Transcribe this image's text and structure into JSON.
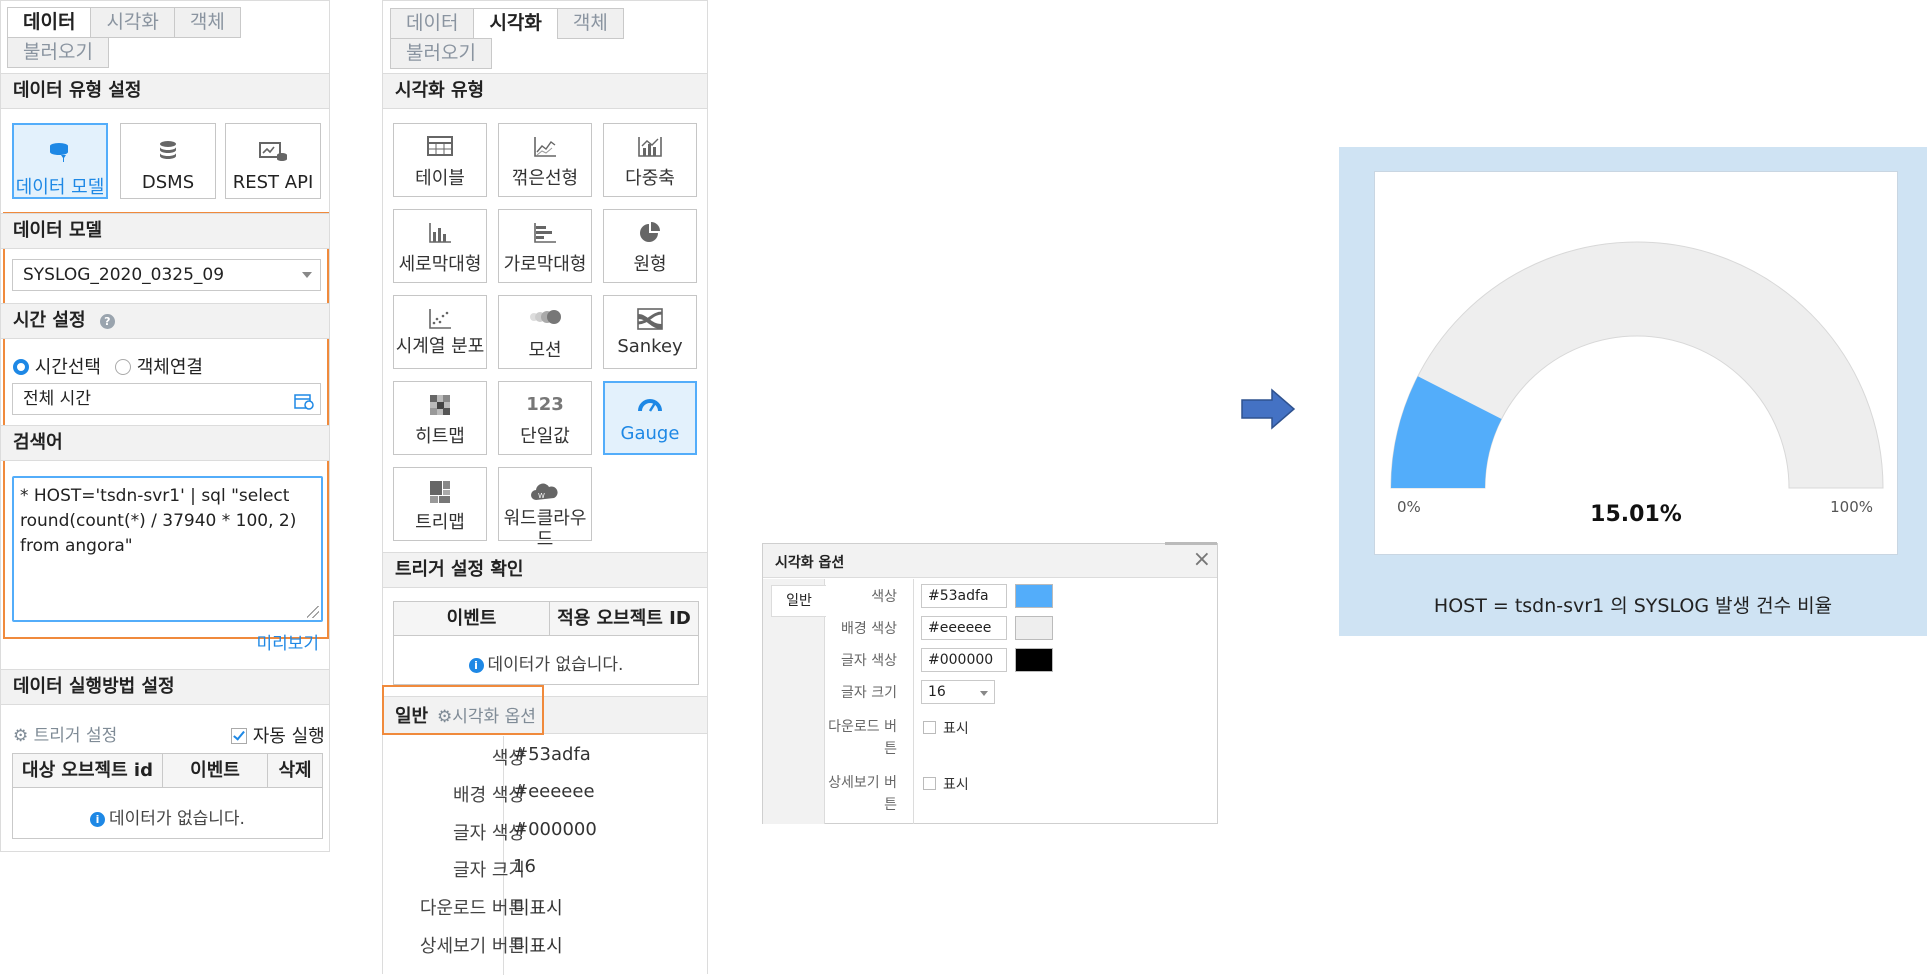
{
  "data_panel": {
    "tabs": [
      "데이터",
      "시각화",
      "객체",
      "불러오기"
    ],
    "data_type_header": "데이터 유형 설정",
    "data_types": [
      {
        "label": "데이터 모델",
        "icon": "data-model-icon",
        "active": true
      },
      {
        "label": "DSMS",
        "icon": "database-icon",
        "active": false
      },
      {
        "label": "REST API",
        "icon": "rest-api-icon",
        "active": false
      }
    ],
    "model_header": "데이터 모델",
    "model_value": "SYSLOG_2020_0325_09",
    "time_header": "시간 설정",
    "time_radio_1": "시간선택",
    "time_radio_2": "객체연결",
    "time_value": "전체 시간",
    "search_header": "검색어",
    "search_query": "*  HOST='tsdn-svr1' |  sql \"select round(count(*) / 37940 * 100, 2) from angora\"",
    "preview_link": "미리보기",
    "exec_header": "데이터 실행방법 설정",
    "trigger_label": "트리거 설정",
    "auto_run_label": "자동 실행",
    "table_headers": [
      "대상 오브젝트 id",
      "이벤트",
      "삭제"
    ],
    "no_data": "데이터가 없습니다."
  },
  "vis_panel": {
    "tabs": [
      "데이터",
      "시각화",
      "객체",
      "불러오기"
    ],
    "vis_type_header": "시각화 유형",
    "vis_types": [
      {
        "label": "테이블",
        "icon": "table-icon"
      },
      {
        "label": "꺾은선형",
        "icon": "line-chart-icon"
      },
      {
        "label": "다중축",
        "icon": "multi-axis-icon"
      },
      {
        "label": "세로막대형",
        "icon": "column-chart-icon"
      },
      {
        "label": "가로막대형",
        "icon": "bar-chart-icon"
      },
      {
        "label": "원형",
        "icon": "pie-chart-icon"
      },
      {
        "label": "시계열 분포",
        "icon": "timeseries-icon"
      },
      {
        "label": "모션",
        "icon": "motion-icon"
      },
      {
        "label": "Sankey",
        "icon": "sankey-icon"
      },
      {
        "label": "히트맵",
        "icon": "heatmap-icon"
      },
      {
        "label": "단일값",
        "icon": "single-value-icon",
        "icon_text": "123"
      },
      {
        "label": "Gauge",
        "icon": "gauge-icon",
        "active": true
      },
      {
        "label": "트리맵",
        "icon": "treemap-icon"
      },
      {
        "label": "워드클라우드",
        "icon": "wordcloud-icon"
      }
    ],
    "trigger_header": "트리거 설정 확인",
    "trigger_table_headers": [
      "이벤트",
      "적용 오브젝트 ID"
    ],
    "no_data": "데이터가 없습니다.",
    "subtab_general": "일반",
    "subtab_options": "시각화 옵션",
    "props": [
      {
        "key": "색상",
        "value": "#53adfa"
      },
      {
        "key": "배경 색상",
        "value": "#eeeeee"
      },
      {
        "key": "글자 색상",
        "value": "#000000"
      },
      {
        "key": "글자 크기",
        "value": "16"
      },
      {
        "key": "다운로드 버튼",
        "value": "미표시"
      },
      {
        "key": "상세보기 버튼",
        "value": "미표시"
      }
    ]
  },
  "options_dialog": {
    "title": "시각화 옵션",
    "close": "×",
    "tab": "일반",
    "color_label": "색상",
    "color_value": "#53adfa",
    "bg_label": "배경 색상",
    "bg_value": "#eeeeee",
    "font_color_label": "글자 색상",
    "font_color_value": "#000000",
    "font_size_label": "글자 크기",
    "font_size_value": "16",
    "download_label_1": "다운로드 버",
    "download_label_2": "튼",
    "detail_label_1": "상세보기 버",
    "detail_label_2": "튼",
    "show_label": "표시"
  },
  "gauge": {
    "value": 15.01,
    "min": 0,
    "max": 100,
    "value_label": "15.01%",
    "min_label": "0%",
    "max_label": "100%",
    "fill_color": "#53adfa",
    "track_color": "#eeeeee",
    "frame_color": "#cfe3f3",
    "caption": "HOST = tsdn-svr1 의 SYSLOG 발생 건수 비율"
  },
  "arrow_color": "#4472c4"
}
